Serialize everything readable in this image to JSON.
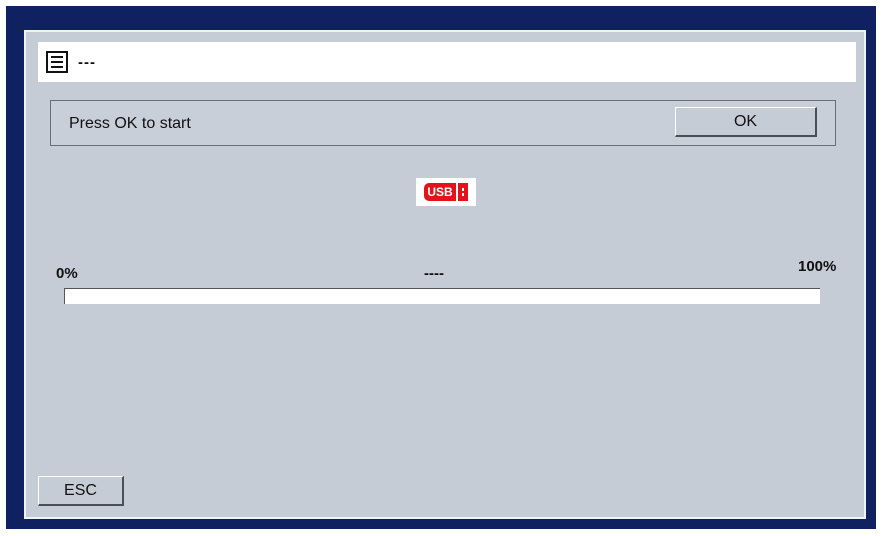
{
  "header": {
    "title": "---",
    "icon": "menu-list-icon"
  },
  "message": {
    "text": "Press OK to start",
    "ok_label": "OK"
  },
  "usb": {
    "label": "USB",
    "icon": "usb-drive-icon",
    "color": "#e3121b"
  },
  "progress": {
    "min_label": "0%",
    "status": "----",
    "max_label": "100%",
    "value": 0
  },
  "footer": {
    "esc_label": "ESC"
  },
  "colors": {
    "frame": "#0f2161",
    "panel": "#c5ccd6"
  }
}
